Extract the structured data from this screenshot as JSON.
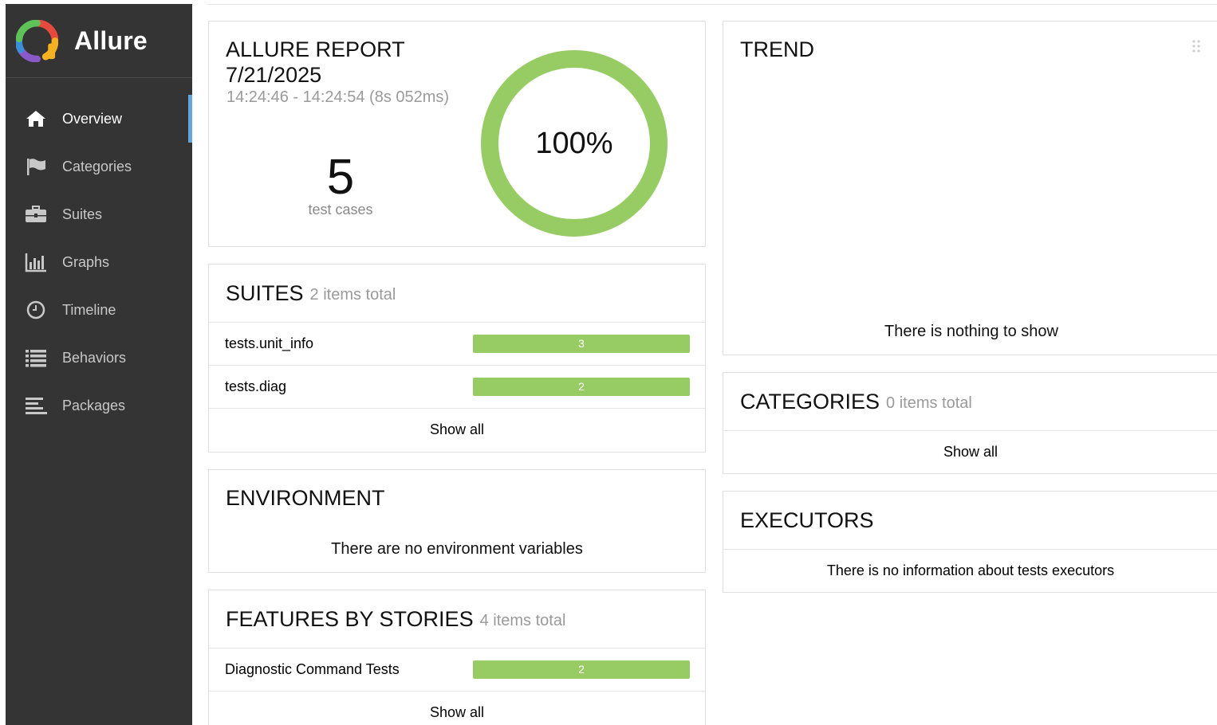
{
  "brand": {
    "name": "Allure"
  },
  "nav": [
    {
      "label": "Overview",
      "icon": "home-icon",
      "active": true
    },
    {
      "label": "Categories",
      "icon": "flag-icon"
    },
    {
      "label": "Suites",
      "icon": "briefcase-icon"
    },
    {
      "label": "Graphs",
      "icon": "bar-chart-icon"
    },
    {
      "label": "Timeline",
      "icon": "clock-icon"
    },
    {
      "label": "Behaviors",
      "icon": "list-icon"
    },
    {
      "label": "Packages",
      "icon": "align-left-icon"
    }
  ],
  "report": {
    "title": "ALLURE REPORT",
    "date": "7/21/2025",
    "time_range": "14:24:46 - 14:24:54 (8s 052ms)",
    "test_count": "5",
    "test_count_label": "test cases",
    "pass_percent": "100%",
    "pass_fraction": 1.0,
    "ring_color": "#97cc64"
  },
  "suites": {
    "title": "SUITES",
    "total": "2 items total",
    "items": [
      {
        "name": "tests.unit_info",
        "count": "3"
      },
      {
        "name": "tests.diag",
        "count": "2"
      }
    ],
    "show_all": "Show all"
  },
  "environment": {
    "title": "ENVIRONMENT",
    "message": "There are no environment variables"
  },
  "features": {
    "title": "FEATURES BY STORIES",
    "total": "4 items total",
    "items": [
      {
        "name": "Diagnostic Command Tests",
        "count": "2"
      }
    ],
    "show_all": "Show all"
  },
  "trend": {
    "title": "TREND",
    "message": "There is nothing to show"
  },
  "categories": {
    "title": "CATEGORIES",
    "total": "0 items total",
    "show_all": "Show all"
  },
  "executors": {
    "title": "EXECUTORS",
    "message": "There is no information about tests executors"
  },
  "colors": {
    "sidebar": "#343434",
    "accent": "#62a7dc",
    "passed": "#97cc64"
  }
}
